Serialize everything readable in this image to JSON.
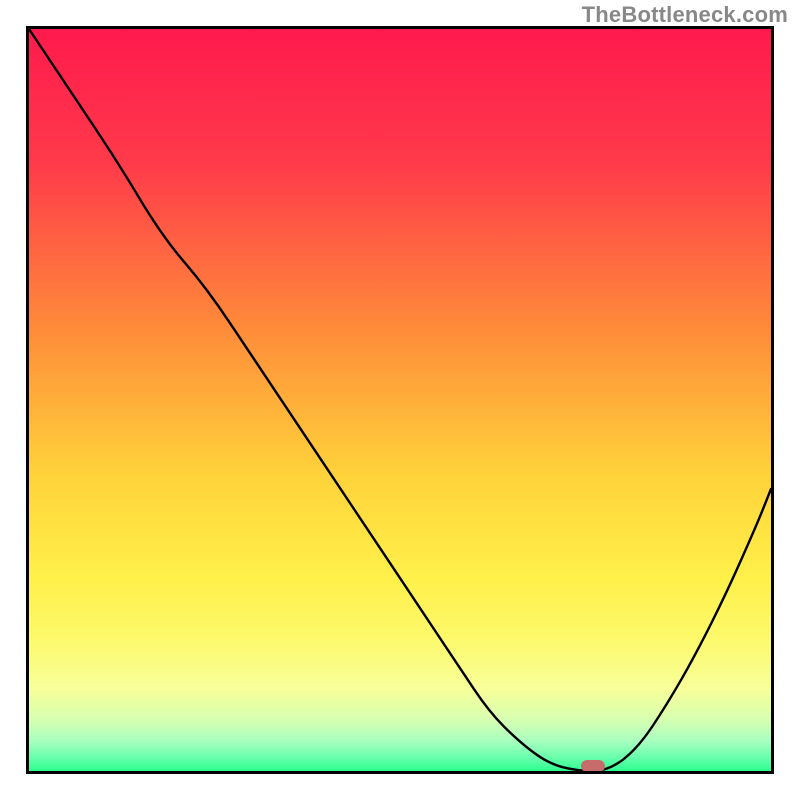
{
  "attribution": "TheBottleneck.com",
  "colors": {
    "border": "#000000",
    "curve": "#000000",
    "marker": "#c86b6b",
    "gradient_stops": [
      {
        "pct": 0,
        "color": "#ff1a4d"
      },
      {
        "pct": 18,
        "color": "#ff3a4a"
      },
      {
        "pct": 40,
        "color": "#ff8a3a"
      },
      {
        "pct": 60,
        "color": "#ffd23a"
      },
      {
        "pct": 74,
        "color": "#fff04a"
      },
      {
        "pct": 82,
        "color": "#fdf96a"
      },
      {
        "pct": 89,
        "color": "#f7ff9a"
      },
      {
        "pct": 93,
        "color": "#d8ffb0"
      },
      {
        "pct": 96,
        "color": "#a8ffc0"
      },
      {
        "pct": 98.5,
        "color": "#5effa8"
      },
      {
        "pct": 100,
        "color": "#2cff8e"
      }
    ]
  },
  "chart_data": {
    "type": "line",
    "title": "",
    "xlabel": "",
    "ylabel": "",
    "xlim": [
      0,
      100
    ],
    "ylim": [
      0,
      100
    ],
    "grid": false,
    "legend": false,
    "series": [
      {
        "name": "bottleneck-curve",
        "x": [
          0,
          6,
          12,
          18,
          24,
          30,
          36,
          42,
          48,
          54,
          58,
          62,
          66,
          70,
          74,
          78,
          82,
          86,
          90,
          94,
          98,
          100
        ],
        "y": [
          100,
          91,
          82,
          72,
          65,
          56,
          47,
          38,
          29,
          20,
          14,
          8,
          4,
          1,
          0,
          0,
          3,
          9,
          16,
          24,
          33,
          38
        ]
      }
    ],
    "marker": {
      "x": 76,
      "y": 0.7
    },
    "notes": "x and y in percent of plot area; (0,0) is bottom-left. Curve is a V-shaped bottleneck profile with minimum (optimal) near x≈76%."
  }
}
